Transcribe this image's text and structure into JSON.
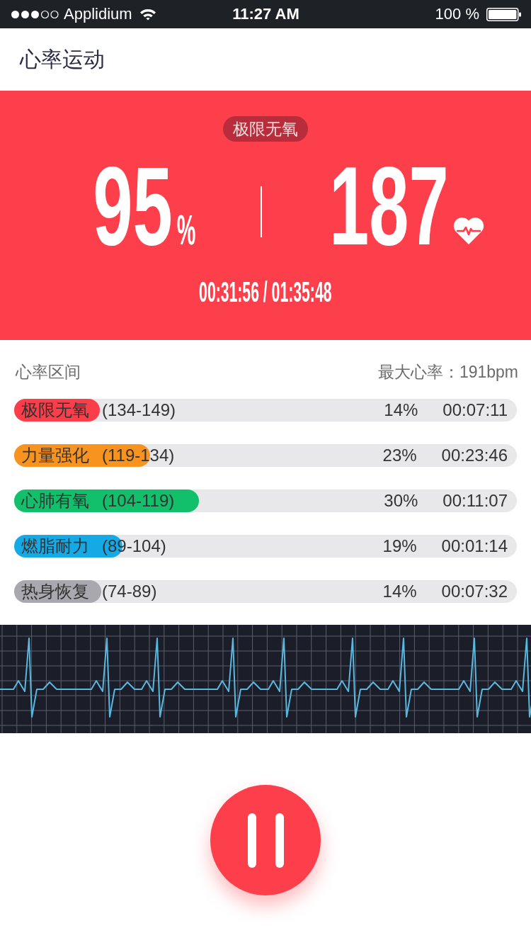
{
  "status_bar": {
    "carrier": "Applidium",
    "time": "11:27 AM",
    "battery": "100 %"
  },
  "header": {
    "title": "心率运动"
  },
  "summary": {
    "zone_badge": "极限无氧",
    "percent": "95",
    "percent_unit": "%",
    "heart_rate": "187",
    "elapsed": "00:31:56 / 01:35:48"
  },
  "zones": {
    "title": "心率区间",
    "max_rate": "最大心率：191bpm",
    "items": [
      {
        "name": "极限无氧",
        "range": "(134-149)",
        "percent": "14%",
        "time": "00:07:11",
        "color": "#fc3d4a",
        "level": 0.17
      },
      {
        "name": "力量强化",
        "range": "(119-134)",
        "percent": "23%",
        "time": "00:23:46",
        "color": "#f7931e",
        "level": 0.27
      },
      {
        "name": "心肺有氧",
        "range": "(104-119)",
        "percent": "30%",
        "time": "00:11:07",
        "color": "#12bf6a",
        "level": 0.367
      },
      {
        "name": "燃脂耐力",
        "range": "(89-104)",
        "percent": "19%",
        "time": "00:01:14",
        "color": "#15a9e6",
        "level": 0.215
      },
      {
        "name": "热身恢复",
        "range": "(74-89)",
        "percent": "14%",
        "time": "00:07:32",
        "color": "#a8a8ae",
        "level": 0.173
      }
    ]
  }
}
